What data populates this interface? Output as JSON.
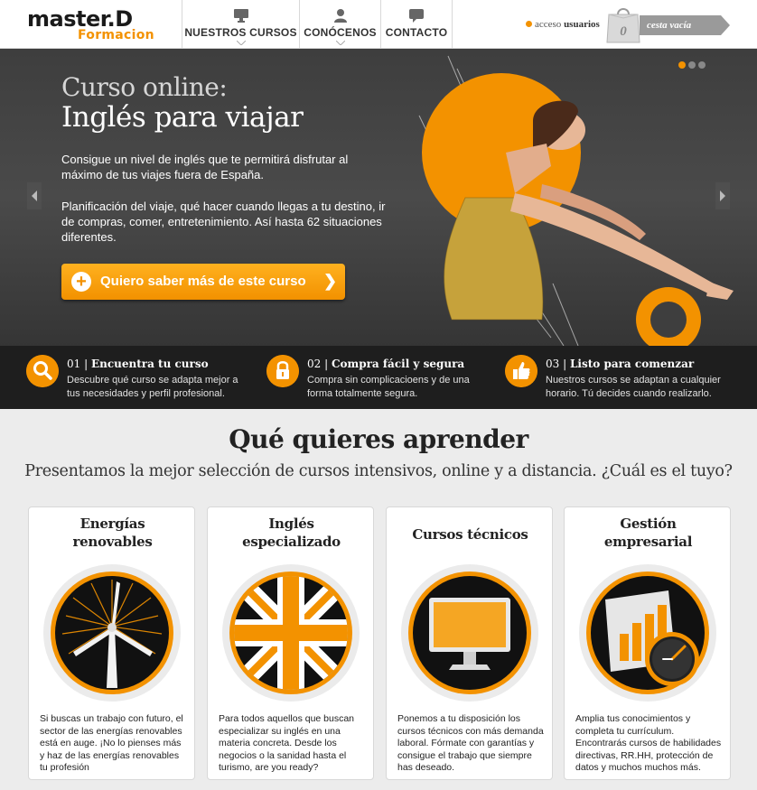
{
  "brand": {
    "logo_top": "master.D",
    "logo_bottom": "Formacion",
    "accent": "#f39200"
  },
  "nav": {
    "items": [
      {
        "label": "NUESTROS CURSOS",
        "icon": "monitor-icon"
      },
      {
        "label": "CONÓCENOS",
        "icon": "user-icon"
      },
      {
        "label": "CONTACTO",
        "icon": "chat-bubble-icon"
      }
    ]
  },
  "account": {
    "prefix": "acceso",
    "label": "usuarios"
  },
  "cart": {
    "count": "0",
    "label": "cesta vacía"
  },
  "hero": {
    "title_line1": "Curso online:",
    "title_line2": "Inglés para viajar",
    "paragraph1": "Consigue un nivel de inglés que te permitirá disfrutar al máximo de tus viajes fuera de España.",
    "paragraph2": "Planificación del viaje, qué hacer cuando llegas a tu destino, ir de compras, comer, entretenimiento. Así hasta 62 situaciones diferentes.",
    "cta_label": "Quiero saber más de este curso",
    "slides_total": 3,
    "slide_active": 1
  },
  "features": [
    {
      "number": "01 |",
      "title": "Encuentra tu curso",
      "description": "Descubre qué curso se adapta mejor a tus necesidades y perfil profesional.",
      "icon": "magnifier-icon"
    },
    {
      "number": "02 |",
      "title": "Compra fácil y segura",
      "description": "Compra sin complicacioens y de una forma totalmente segura.",
      "icon": "padlock-icon"
    },
    {
      "number": "03 |",
      "title": "Listo para comenzar",
      "description": "Nuestros cursos se adaptan a cualquier horario. Tú decides cuando realizarlo.",
      "icon": "thumbs-up-icon"
    }
  ],
  "section": {
    "title": "Qué quieres aprender",
    "subtitle": "Presentamos la mejor selección de cursos intensivos, online y a distancia. ¿Cuál es el tuyo?"
  },
  "cards": [
    {
      "title_line1": "Energías",
      "title_line2": "renovables",
      "icon": "wind-turbine-icon",
      "text": "Si buscas un trabajo con futuro, el sector de las energías renovables está en auge. ¡No lo pienses más y haz de las energías renovables tu profesión"
    },
    {
      "title_line1": "Inglés",
      "title_line2": "especializado",
      "icon": "union-jack-icon",
      "text": "Para todos aquellos que buscan especializar su inglés en una materia concreta. Desde los negocios o la sanidad hasta el turismo, are you ready?"
    },
    {
      "title_line1": "Cursos técnicos",
      "title_line2": "",
      "icon": "computer-monitor-icon",
      "text": "Ponemos a tu disposición los cursos técnicos con más demanda laboral. Fórmate con garantías y consigue el trabajo que siempre has deseado."
    },
    {
      "title_line1": "Gestión",
      "title_line2": "empresarial",
      "icon": "chart-clock-icon",
      "text": "Amplia tus conocimientos y completa tu currículum. Encontrarás cursos de habilidades directivas, RR.HH, protección de datos y muchos muchos más."
    }
  ]
}
